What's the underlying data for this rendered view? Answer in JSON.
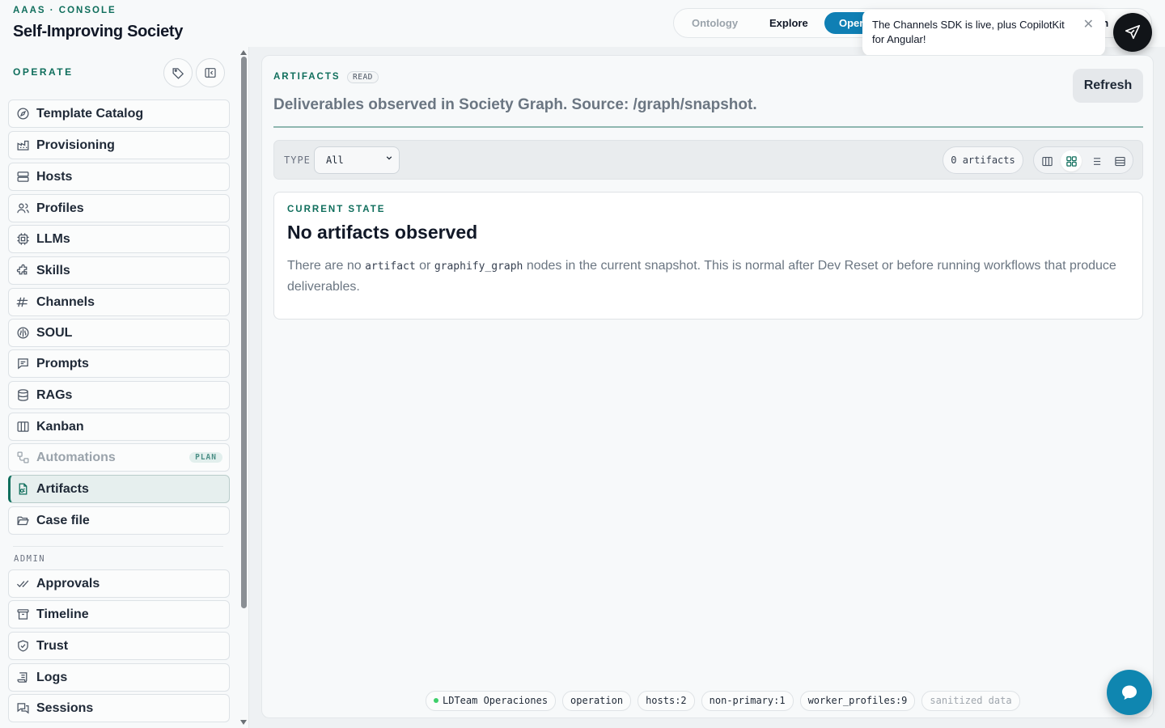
{
  "brand": {
    "eyebrow": "AAAS · CONSOLE",
    "title": "Self-Improving Society"
  },
  "nav": {
    "tabs": [
      {
        "label": "Ontology",
        "state": "muted"
      },
      {
        "label": "Explore",
        "state": "normal"
      },
      {
        "label": "Oper",
        "state": "active"
      }
    ],
    "hidden_tab_fragment": "an"
  },
  "toast": {
    "message": "The Channels SDK is live, plus CopilotKit for Angular!",
    "close_icon": "close-icon",
    "orb_icon": "paper-plane-icon"
  },
  "sidebar": {
    "section": "OPERATE",
    "tools": [
      "tag-icon",
      "collapse-sidebar-icon"
    ],
    "items": [
      {
        "label": "Template Catalog",
        "icon": "compass-icon"
      },
      {
        "label": "Provisioning",
        "icon": "factory-icon"
      },
      {
        "label": "Hosts",
        "icon": "server-icon"
      },
      {
        "label": "Profiles",
        "icon": "users-icon"
      },
      {
        "label": "LLMs",
        "icon": "cpu-icon"
      },
      {
        "label": "Skills",
        "icon": "puzzle-icon"
      },
      {
        "label": "Channels",
        "icon": "broadcast-icon"
      },
      {
        "label": "SOUL",
        "icon": "brain-icon"
      },
      {
        "label": "Prompts",
        "icon": "message-square-icon"
      },
      {
        "label": "RAGs",
        "icon": "database-icon"
      },
      {
        "label": "Kanban",
        "icon": "columns-icon"
      },
      {
        "label": "Automations",
        "icon": "workflow-icon",
        "disabled": true,
        "badge": "PLAN"
      },
      {
        "label": "Artifacts",
        "icon": "file-artifact-icon",
        "active": true
      },
      {
        "label": "Case file",
        "icon": "folder-open-icon"
      }
    ],
    "admin_section": "ADMIN",
    "admin_items": [
      {
        "label": "Approvals",
        "icon": "double-check-icon"
      },
      {
        "label": "Timeline",
        "icon": "archive-icon"
      },
      {
        "label": "Trust",
        "icon": "shield-check-icon"
      },
      {
        "label": "Logs",
        "icon": "scroll-icon"
      },
      {
        "label": "Sessions",
        "icon": "chat-bubbles-icon"
      }
    ]
  },
  "main": {
    "eyebrow": "ARTIFACTS",
    "read_badge": "READ",
    "subtitle": "Deliverables observed in Society Graph. Source: /graph/snapshot.",
    "refresh_label": "Refresh",
    "filter": {
      "type_label": "TYPE",
      "type_value": "All",
      "count_label": "0 artifacts",
      "views": [
        "columns-view-icon",
        "grid-view-icon",
        "list-view-icon",
        "table-view-icon"
      ],
      "active_view": 1
    },
    "state_card": {
      "eyebrow": "CURRENT STATE",
      "title": "No artifacts observed",
      "desc_before": "There are no ",
      "code_1": "artifact",
      "desc_mid": " or ",
      "code_2": "graphify_graph",
      "desc_after": " nodes in the current snapshot. This is normal after Dev Reset or before running workflows that produce deliverables."
    }
  },
  "footer": {
    "chips": [
      "LDTeam Operaciones",
      "operation",
      "hosts:2",
      "non-primary:1",
      "worker_profiles:9",
      "sanitized data"
    ]
  },
  "chat_fab_icon": "chat-icon",
  "colors": {
    "accent": "#0f6e5c",
    "nav_active": "#0f7fb4",
    "chat_fab": "#0f86b0",
    "status_dot": "#3ecf6a"
  }
}
